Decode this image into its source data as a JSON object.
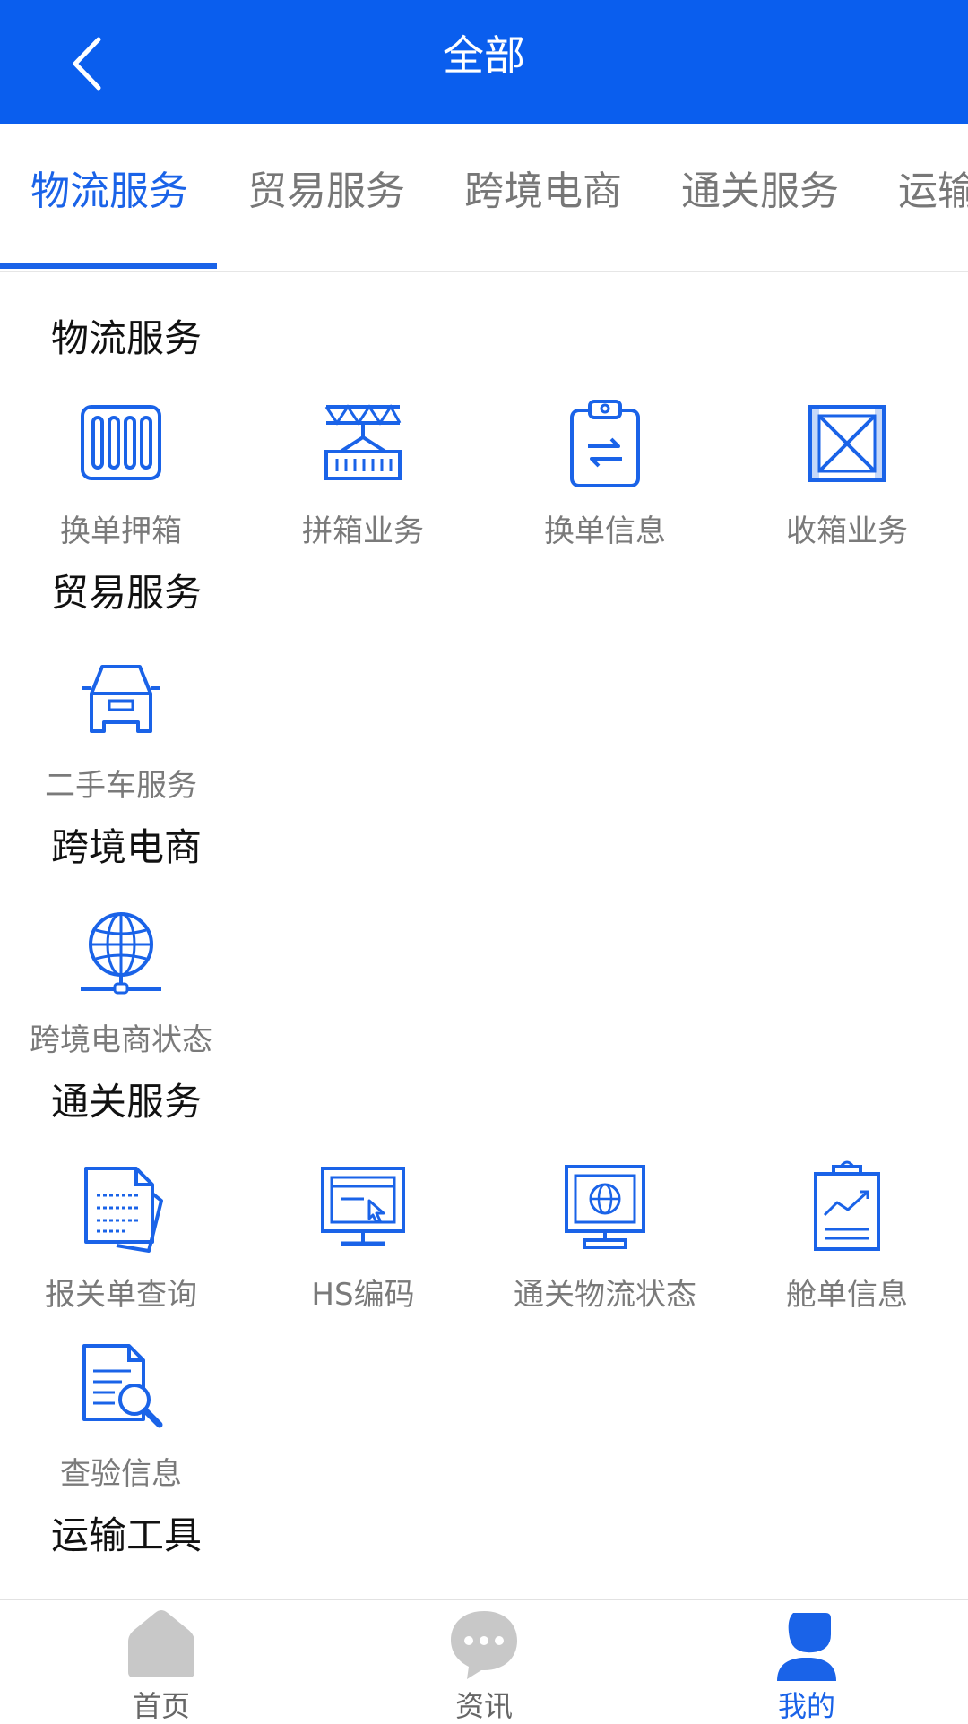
{
  "header": {
    "title": "全部",
    "back_icon": "chevron-left-icon"
  },
  "tabs": [
    {
      "label": "物流服务",
      "active": true
    },
    {
      "label": "贸易服务",
      "active": false
    },
    {
      "label": "跨境电商",
      "active": false
    },
    {
      "label": "通关服务",
      "active": false
    },
    {
      "label": "运输",
      "active": false
    }
  ],
  "sections": [
    {
      "title": "物流服务",
      "items": [
        {
          "label": "换单押箱",
          "icon": "container-icon"
        },
        {
          "label": "拼箱业务",
          "icon": "crane-container-icon"
        },
        {
          "label": "换单信息",
          "icon": "clipboard-swap-icon"
        },
        {
          "label": "收箱业务",
          "icon": "crate-icon"
        }
      ]
    },
    {
      "title": "贸易服务",
      "items": [
        {
          "label": "二手车服务",
          "icon": "car-icon"
        }
      ]
    },
    {
      "title": "跨境电商",
      "items": [
        {
          "label": "跨境电商状态",
          "icon": "globe-network-icon"
        }
      ]
    },
    {
      "title": "通关服务",
      "items": [
        {
          "label": "报关单查询",
          "icon": "documents-icon"
        },
        {
          "label": "HS编码",
          "icon": "monitor-cursor-icon"
        },
        {
          "label": "通关物流状态",
          "icon": "monitor-globe-icon"
        },
        {
          "label": "舱单信息",
          "icon": "clipboard-chart-icon"
        },
        {
          "label": "查验信息",
          "icon": "document-search-icon"
        }
      ]
    },
    {
      "title": "运输工具",
      "items": []
    }
  ],
  "bottom_nav": [
    {
      "label": "首页",
      "icon": "home-icon",
      "active": false
    },
    {
      "label": "资讯",
      "icon": "chat-bubble-icon",
      "active": false
    },
    {
      "label": "我的",
      "icon": "user-icon",
      "active": true
    }
  ],
  "colors": {
    "primary": "#0a5eee",
    "accent": "#1a63e8",
    "icon_inactive": "#c8c8c8"
  }
}
